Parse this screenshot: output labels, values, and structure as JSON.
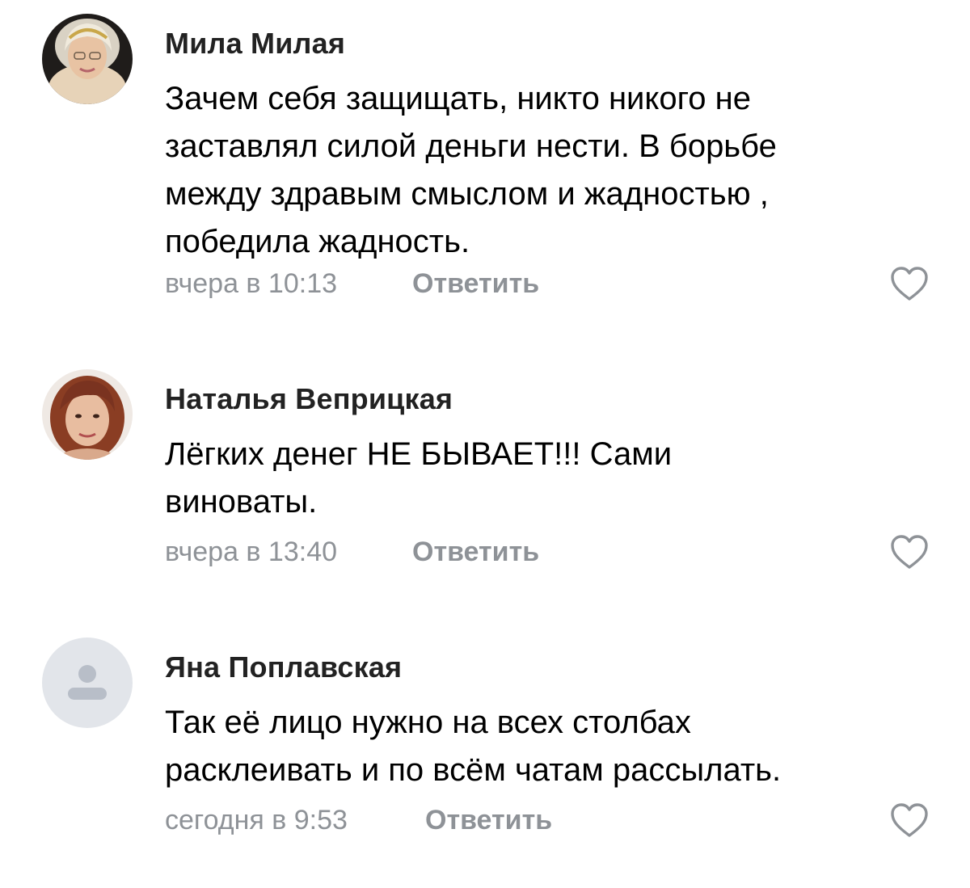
{
  "comments": [
    {
      "author": "Мила Милая",
      "lines": [
        "Зачем себя защищать, никто никого не",
        "заставлял силой деньги нести. В борьбе",
        "между здравым смыслом и жадностью ,",
        "победила жадность."
      ],
      "time": "вчера в 10:13",
      "reply_label": "Ответить",
      "avatar_icon": "user-photo"
    },
    {
      "author": "Наталья Веприцкая",
      "lines": [
        "Лёгких денег НЕ БЫВАЕТ!!!  Сами",
        "виноваты."
      ],
      "time": "вчера в 13:40",
      "reply_label": "Ответить",
      "avatar_icon": "user-photo"
    },
    {
      "author": "Яна Поплавская",
      "lines": [
        "Так её лицо нужно на всех столбах",
        "расклеивать и по всём чатам рассылать."
      ],
      "time": "сегодня в 9:53",
      "reply_label": "Ответить",
      "avatar_icon": "default-user-icon"
    }
  ],
  "icons": {
    "like": "heart-outline-icon"
  },
  "colors": {
    "text": "#000000",
    "author": "#222222",
    "meta": "#8e9297",
    "default_avatar_bg": "#e2e5ea",
    "default_avatar_fg": "#b8bec8"
  }
}
